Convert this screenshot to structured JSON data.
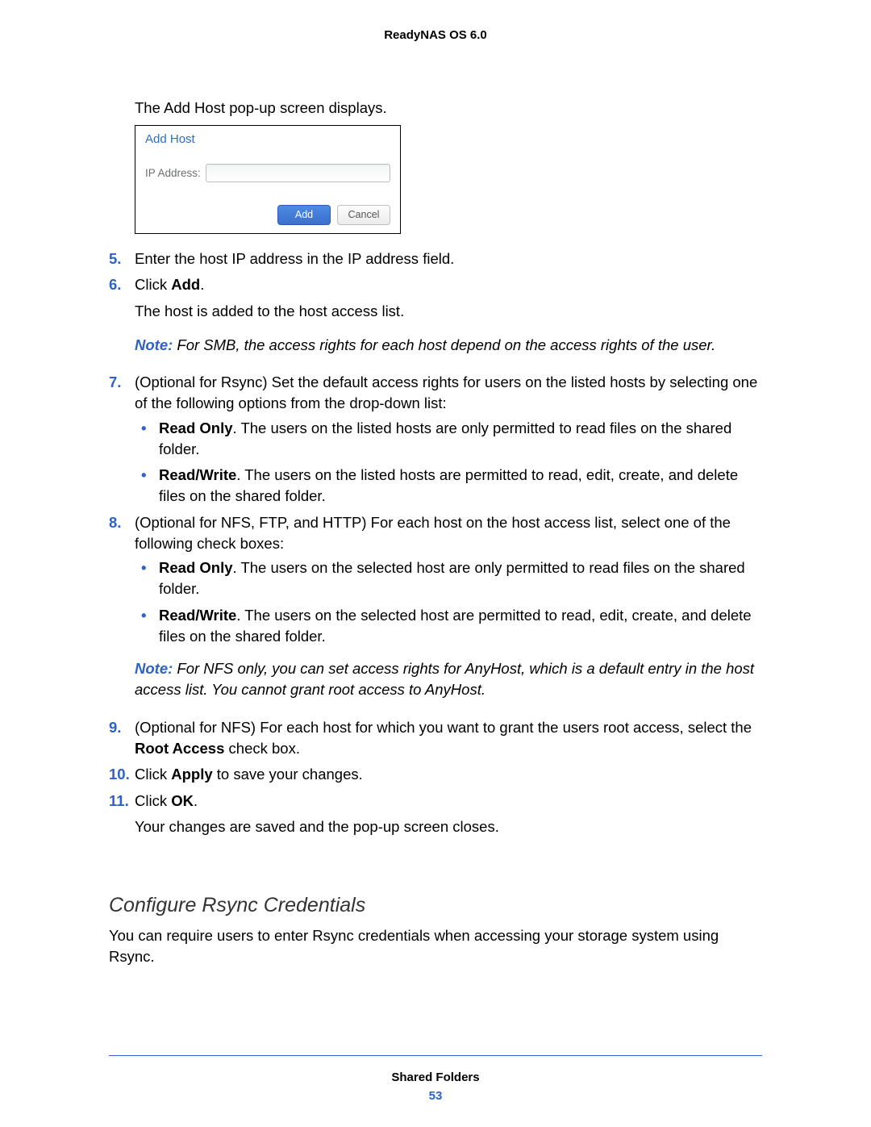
{
  "running_head": "ReadyNAS OS 6.0",
  "intro": "The Add Host pop-up screen displays.",
  "dialog": {
    "title": "Add Host",
    "ip_label": "IP Address:",
    "add_btn": "Add",
    "cancel_btn": "Cancel"
  },
  "steps": {
    "s5": "Enter the host IP address in the IP address field.",
    "s6_prefix": "Click ",
    "s6_bold": "Add",
    "s6_suffix": ".",
    "s6_followup": "The host is added to the host access list.",
    "note1_label": "Note: ",
    "note1_body": " For SMB, the access rights for each host depend on the access rights of the user.",
    "s7": "(Optional for Rsync) Set the default access rights for users on the listed hosts by selecting one of the following options from the drop-down list:",
    "s7_b1_bold": "Read Only",
    "s7_b1_rest": ". The users on the listed hosts are only permitted to read files on the shared folder.",
    "s7_b2_bold": "Read/Write",
    "s7_b2_rest": ". The users on the listed hosts are permitted to read, edit, create, and delete files on the shared folder.",
    "s8": "(Optional for NFS, FTP, and HTTP) For each host on the host access list, select one of the following check boxes:",
    "s8_b1_bold": "Read Only",
    "s8_b1_rest": ". The users on the selected host are only permitted to read files on the shared folder.",
    "s8_b2_bold": "Read/Write",
    "s8_b2_rest": ". The users on the selected host are permitted to read, edit, create, and delete files on the shared folder.",
    "note2_label": "Note: ",
    "note2_body": " For NFS only, you can set access rights for AnyHost, which is a default entry in the host access list. You cannot grant root access to AnyHost.",
    "s9_a": "(Optional for NFS) For each host for which you want to grant the users root access, select the ",
    "s9_bold": "Root Access",
    "s9_b": " check box.",
    "s10_prefix": "Click ",
    "s10_bold": "Apply",
    "s10_suffix": " to save your changes.",
    "s11_prefix": "Click ",
    "s11_bold": "OK",
    "s11_suffix": ".",
    "s11_followup": "Your changes are saved and the pop-up screen closes."
  },
  "section": {
    "heading": "Configure Rsync Credentials",
    "body": "You can require users to enter Rsync credentials when accessing your storage system using Rsync."
  },
  "footer": {
    "title": "Shared Folders",
    "page": "53"
  }
}
